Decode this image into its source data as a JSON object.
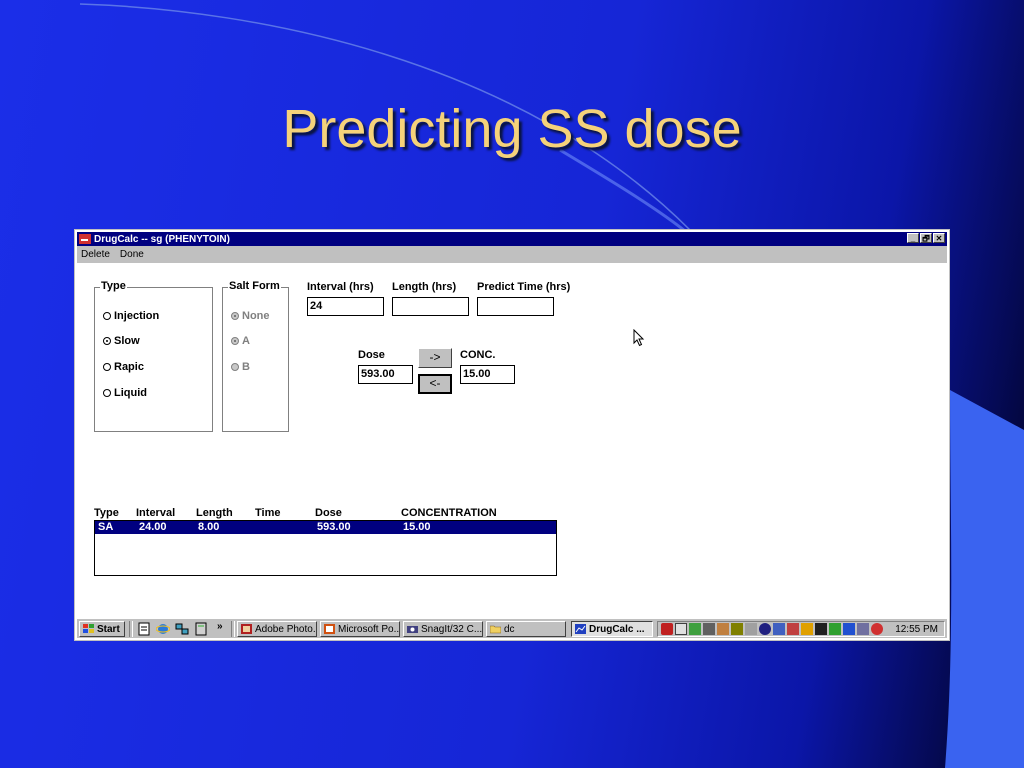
{
  "slide": {
    "title": "Predicting SS dose"
  },
  "window": {
    "title": "DrugCalc -- sg (PHENYTOIN)",
    "buttons": [
      "_",
      "🗗",
      "✕"
    ],
    "menu": [
      "Delete",
      "Done"
    ]
  },
  "type_group": {
    "legend": "Type",
    "options": [
      {
        "label": "Injection",
        "selected": false
      },
      {
        "label": "Slow",
        "selected": true
      },
      {
        "label": "Rapic",
        "selected": false
      },
      {
        "label": "Liquid",
        "selected": false
      }
    ]
  },
  "salt_group": {
    "legend": "Salt Form",
    "options": [
      {
        "label": "None",
        "selected": true
      },
      {
        "label": "A",
        "selected": true
      },
      {
        "label": "B",
        "selected": false
      }
    ]
  },
  "fields": {
    "interval_label": "Interval (hrs)",
    "interval_value": "24",
    "length_label": "Length (hrs)",
    "length_value": "",
    "predict_label": "Predict Time (hrs)",
    "predict_value": "",
    "dose_label": "Dose",
    "dose_value": "593.00",
    "conc_label": "CONC.",
    "conc_value": "15.00",
    "forward_button": "->",
    "back_button": "<-"
  },
  "results": {
    "headers": [
      "Type",
      "Interval",
      "Length",
      "Time",
      "Dose",
      "CONCENTRATION"
    ],
    "rows": [
      [
        "SA",
        "24.00",
        "8.00",
        "",
        "593.00",
        "15.00"
      ]
    ]
  },
  "taskbar": {
    "start": "Start",
    "more": "»",
    "tasks": [
      {
        "label": "Adobe Photo...",
        "active": false
      },
      {
        "label": "Microsoft Po...",
        "active": false
      },
      {
        "label": "SnagIt/32 C...",
        "active": false
      },
      {
        "label": "dc",
        "active": false
      },
      {
        "label": "DrugCalc ...",
        "active": true
      }
    ],
    "clock": "12:55 PM"
  }
}
